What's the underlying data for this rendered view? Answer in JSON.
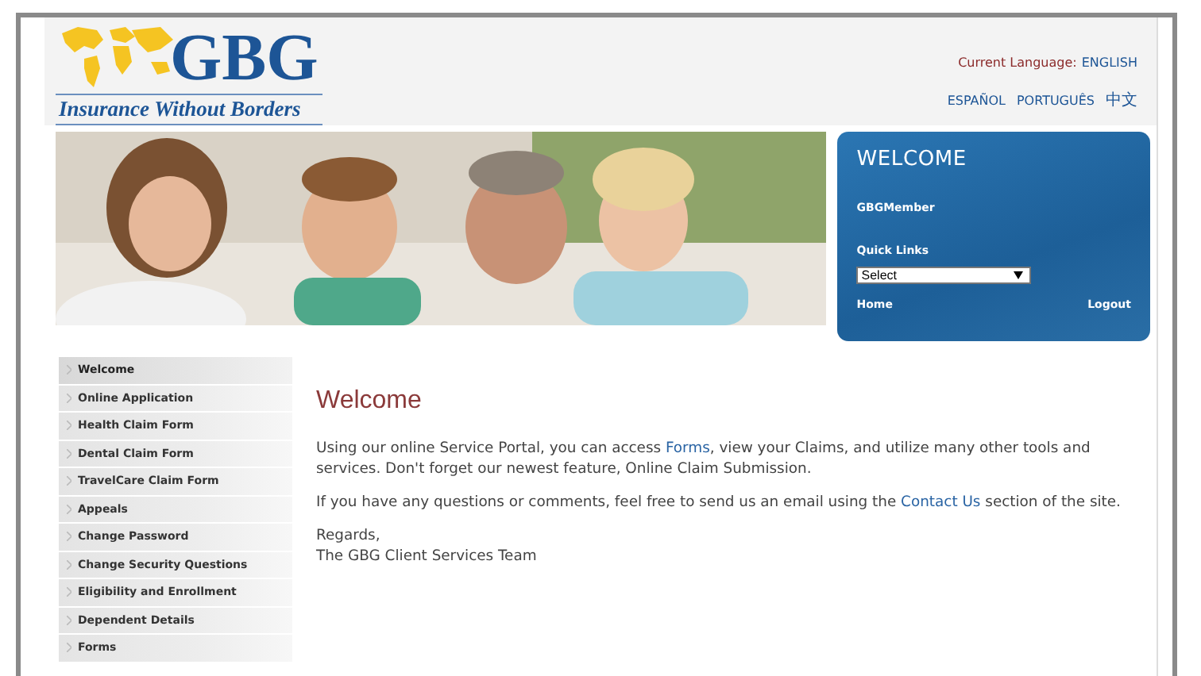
{
  "header": {
    "logo_text": "GBG",
    "tagline": "Insurance Without Borders",
    "current_language_label": "Current Language:",
    "current_language": "ENGLISH",
    "languages": [
      "ESPAÑOL",
      "PORTUGUÊS",
      "中文"
    ]
  },
  "welcome_panel": {
    "title": "WELCOME",
    "user": "GBGMember",
    "quick_links_label": "Quick Links",
    "quick_links": {
      "value": "Select"
    },
    "links": [
      "Home",
      "Logout"
    ]
  },
  "sidebar": {
    "items": [
      {
        "label": "Welcome",
        "selected": true
      },
      {
        "label": "Online Application",
        "selected": false
      },
      {
        "label": "Health Claim Form",
        "selected": false
      },
      {
        "label": "Dental Claim Form",
        "selected": false
      },
      {
        "label": "TravelCare Claim Form",
        "selected": false
      },
      {
        "label": "Appeals",
        "selected": false
      },
      {
        "label": "Change Password",
        "selected": false
      },
      {
        "label": "Change Security Questions",
        "selected": false
      },
      {
        "label": "Eligibility and Enrollment",
        "selected": false
      },
      {
        "label": "Dependent Details",
        "selected": false
      },
      {
        "label": "Forms",
        "selected": false
      }
    ]
  },
  "content": {
    "title": "Welcome",
    "paragraphs": [
      [
        {
          "kind": "text",
          "text": "Using our online Service Portal, you can access "
        },
        {
          "kind": "link",
          "text": "Forms"
        },
        {
          "kind": "text",
          "text": ", view your Claims, and utilize many other tools and services. Don't forget our newest feature, Online Claim Submission."
        }
      ],
      [
        {
          "kind": "text",
          "text": "If you have any questions or comments, feel free to send us an email using the "
        },
        {
          "kind": "link",
          "text": "Contact Us"
        },
        {
          "kind": "text",
          "text": " section of the site."
        }
      ],
      [
        {
          "kind": "text",
          "text": "Regards,"
        },
        {
          "kind": "break"
        },
        {
          "kind": "text",
          "text": "The GBG Client Services Team"
        }
      ]
    ]
  }
}
